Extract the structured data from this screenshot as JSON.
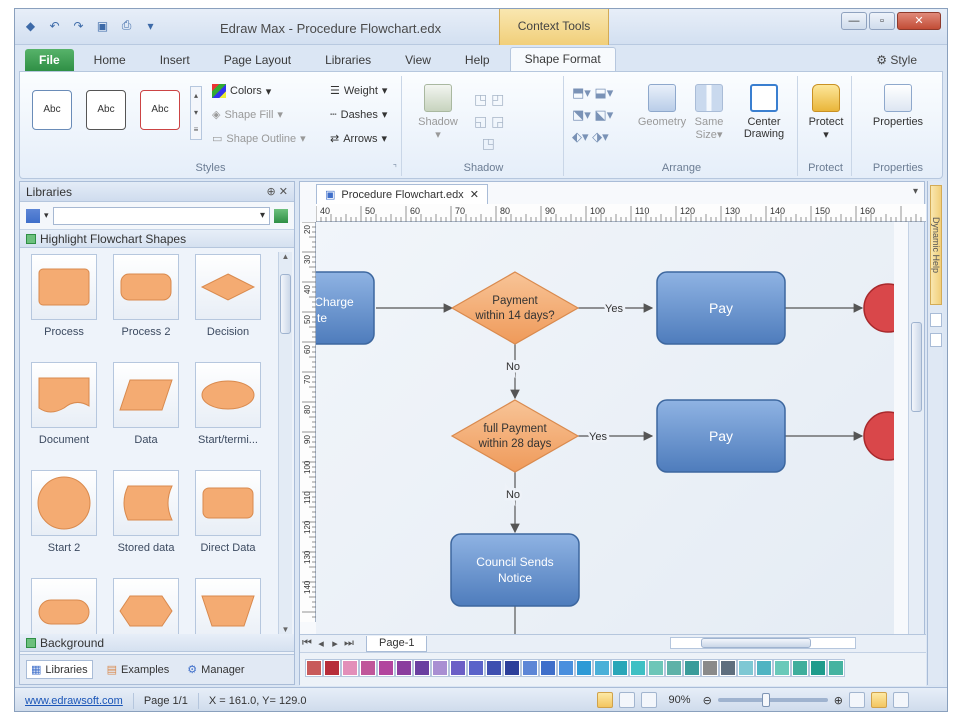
{
  "window": {
    "title": "Edraw Max - Procedure Flowchart.edx",
    "context_tab": "Context Tools"
  },
  "tabs": [
    "File",
    "Home",
    "Insert",
    "Page Layout",
    "Libraries",
    "View",
    "Help",
    "Shape Format"
  ],
  "style_menu": "Style",
  "ribbon": {
    "styles": {
      "label": "Styles",
      "samples": [
        "Abc",
        "Abc",
        "Abc"
      ],
      "colors": "Colors",
      "shape_fill": "Shape Fill",
      "shape_outline": "Shape Outline",
      "weight": "Weight",
      "dashes": "Dashes",
      "arrows": "Arrows"
    },
    "shadow": {
      "label": "Shadow",
      "button": "Shadow"
    },
    "arrange": {
      "label": "Arrange",
      "geometry": "Geometry",
      "same_size_1": "Same",
      "same_size_2": "Size",
      "center_1": "Center",
      "center_2": "Drawing"
    },
    "protect": {
      "label": "Protect",
      "button": "Protect"
    },
    "properties": {
      "label": "Properties",
      "button": "Properties"
    }
  },
  "libraries_panel": {
    "title": "Libraries",
    "category": "Highlight Flowchart Shapes",
    "shapes": [
      "Process",
      "Process 2",
      "Decision",
      "Document",
      "Data",
      "Start/termi...",
      "Start 2",
      "Stored data",
      "Direct Data",
      "",
      "",
      ""
    ],
    "background": "Background",
    "bottom_tabs": [
      "Libraries",
      "Examples",
      "Manager"
    ]
  },
  "document": {
    "tab": "Procedure Flowchart.edx",
    "page_tab": "Page-1",
    "ruler_h": [
      "40",
      "50",
      "60",
      "70",
      "80",
      "90",
      "100",
      "110",
      "120",
      "130",
      "140",
      "150",
      "160"
    ],
    "ruler_v": [
      "20",
      "30",
      "40",
      "50",
      "60",
      "70",
      "80",
      "90",
      "100",
      "110",
      "120",
      "130",
      "140"
    ],
    "right_sidebar": "Dynamic Help"
  },
  "flowchart": {
    "charge": [
      "Charge",
      "te"
    ],
    "decision1": [
      "Payment",
      "within 14 days?"
    ],
    "decision2": [
      "full Payment",
      "within 28 days"
    ],
    "pay1": "Pay",
    "pay2": "Pay",
    "notice": [
      "Council Sends",
      "Notice"
    ],
    "yes": "Yes",
    "no": "No"
  },
  "palette": [
    "#c85a5a",
    "#b72d3a",
    "#e38fb9",
    "#c0569a",
    "#b2459e",
    "#8a3d9e",
    "#6a3fa0",
    "#a98fd2",
    "#6c5fc6",
    "#5a63c9",
    "#3e4fb0",
    "#2c3f9a",
    "#5d86d6",
    "#3f6fca",
    "#4a8fde",
    "#2e9ad6",
    "#4ab0d8",
    "#2aa6b8",
    "#3fc0c4",
    "#6dc6b8",
    "#5eb2a8",
    "#3a9c9a",
    "#8a8a8a",
    "#5e6e7e",
    "#7ec8d4",
    "#4fb4c2",
    "#69c9b9",
    "#3fae9c",
    "#1f9c8c",
    "#45b3a0"
  ],
  "status": {
    "link": "www.edrawsoft.com",
    "page": "Page 1/1",
    "coords": "X = 161.0, Y= 129.0",
    "zoom": "90%"
  },
  "colors": {
    "shape_fill": "#f4ab72",
    "process_blue": "#5b8ac6",
    "accent": "#f1cf7a"
  }
}
